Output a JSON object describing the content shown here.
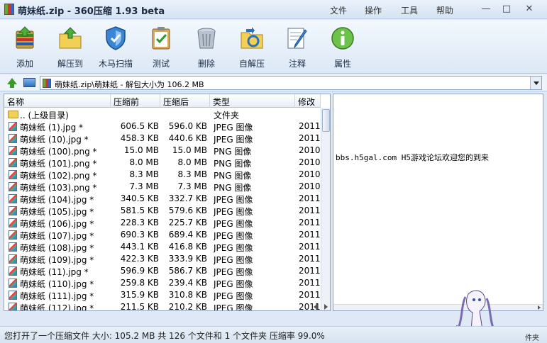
{
  "window": {
    "title": "萌妹纸.zip - 360压缩 1.93 beta",
    "menus": [
      "文件",
      "操作",
      "工具",
      "帮助"
    ],
    "controls": [
      "minimize",
      "maximize",
      "close"
    ]
  },
  "toolbar": {
    "buttons": [
      {
        "label": "添加",
        "icon": "add-archive-icon"
      },
      {
        "label": "解压到",
        "icon": "extract-to-folder-icon"
      },
      {
        "label": "木马扫描",
        "icon": "shield-scan-icon"
      },
      {
        "label": "测试",
        "icon": "test-clipboard-icon"
      },
      {
        "label": "删除",
        "icon": "trash-bin-icon"
      },
      {
        "label": "自解压",
        "icon": "self-extract-folder-icon"
      },
      {
        "label": "注释",
        "icon": "comment-pen-icon"
      },
      {
        "label": "属性",
        "icon": "info-icon"
      }
    ]
  },
  "address": {
    "path": "萌妹纸.zip\\萌妹纸 - 解包大小为 106.2 MB"
  },
  "filelist": {
    "columns": [
      "名称",
      "压缩前",
      "压缩后",
      "类型",
      "修改"
    ],
    "rows": [
      {
        "name": ".. (上级目录)",
        "size": "",
        "packed": "",
        "type": "文件夹",
        "date": "",
        "icon": "folder-icon"
      },
      {
        "name": "萌妹纸 (1).jpg *",
        "size": "606.5 KB",
        "packed": "596.0 KB",
        "type": "JPEG 图像",
        "date": "2011",
        "icon": "image-file-icon"
      },
      {
        "name": "萌妹纸 (10).jpg *",
        "size": "458.3 KB",
        "packed": "440.6 KB",
        "type": "JPEG 图像",
        "date": "2011",
        "icon": "image-file-icon"
      },
      {
        "name": "萌妹纸 (100).png *",
        "size": "15.0 MB",
        "packed": "15.0 MB",
        "type": "PNG 图像",
        "date": "2010",
        "icon": "image-file-icon"
      },
      {
        "name": "萌妹纸 (101).png *",
        "size": "8.0 MB",
        "packed": "8.0 MB",
        "type": "PNG 图像",
        "date": "2010",
        "icon": "image-file-icon"
      },
      {
        "name": "萌妹纸 (102).png *",
        "size": "8.3 MB",
        "packed": "8.3 MB",
        "type": "PNG 图像",
        "date": "2010",
        "icon": "image-file-icon"
      },
      {
        "name": "萌妹纸 (103).png *",
        "size": "7.3 MB",
        "packed": "7.3 MB",
        "type": "PNG 图像",
        "date": "2010",
        "icon": "image-file-icon"
      },
      {
        "name": "萌妹纸 (104).jpg *",
        "size": "340.5 KB",
        "packed": "332.7 KB",
        "type": "JPEG 图像",
        "date": "2011",
        "icon": "image-file-icon"
      },
      {
        "name": "萌妹纸 (105).jpg *",
        "size": "581.5 KB",
        "packed": "579.6 KB",
        "type": "JPEG 图像",
        "date": "2011",
        "icon": "image-file-icon"
      },
      {
        "name": "萌妹纸 (106).jpg *",
        "size": "228.3 KB",
        "packed": "225.7 KB",
        "type": "JPEG 图像",
        "date": "2011",
        "icon": "image-file-icon"
      },
      {
        "name": "萌妹纸 (107).jpg *",
        "size": "690.3 KB",
        "packed": "689.4 KB",
        "type": "JPEG 图像",
        "date": "2011",
        "icon": "image-file-icon"
      },
      {
        "name": "萌妹纸 (108).jpg *",
        "size": "443.1 KB",
        "packed": "416.8 KB",
        "type": "JPEG 图像",
        "date": "2011",
        "icon": "image-file-icon"
      },
      {
        "name": "萌妹纸 (109).jpg *",
        "size": "422.3 KB",
        "packed": "333.9 KB",
        "type": "JPEG 图像",
        "date": "2011",
        "icon": "image-file-icon"
      },
      {
        "name": "萌妹纸 (11).jpg *",
        "size": "596.9 KB",
        "packed": "586.7 KB",
        "type": "JPEG 图像",
        "date": "2011",
        "icon": "image-file-icon"
      },
      {
        "name": "萌妹纸 (110).jpg *",
        "size": "259.8 KB",
        "packed": "239.4 KB",
        "type": "JPEG 图像",
        "date": "2011",
        "icon": "image-file-icon"
      },
      {
        "name": "萌妹纸 (111).jpg *",
        "size": "315.9 KB",
        "packed": "310.8 KB",
        "type": "JPEG 图像",
        "date": "2011",
        "icon": "image-file-icon"
      },
      {
        "name": "萌妹纸 (112).jpg *",
        "size": "211.5 KB",
        "packed": "210.2 KB",
        "type": "JPEG 图像",
        "date": "2011",
        "icon": "image-file-icon"
      }
    ]
  },
  "comment_panel": {
    "text": "bbs.h5gal.com   H5游戏论坛欢迎您的到来"
  },
  "statusbar": {
    "text": "您打开了一个压缩文件 大小: 105.2 MB 共 126 个文件和 1 个文件夹 压缩率 99.0%",
    "watermark_tail": "件夹"
  },
  "colors": {
    "accent": "#2c6fc0",
    "chrome_bg": "#dfe9f5",
    "border": "#8da5c4"
  }
}
